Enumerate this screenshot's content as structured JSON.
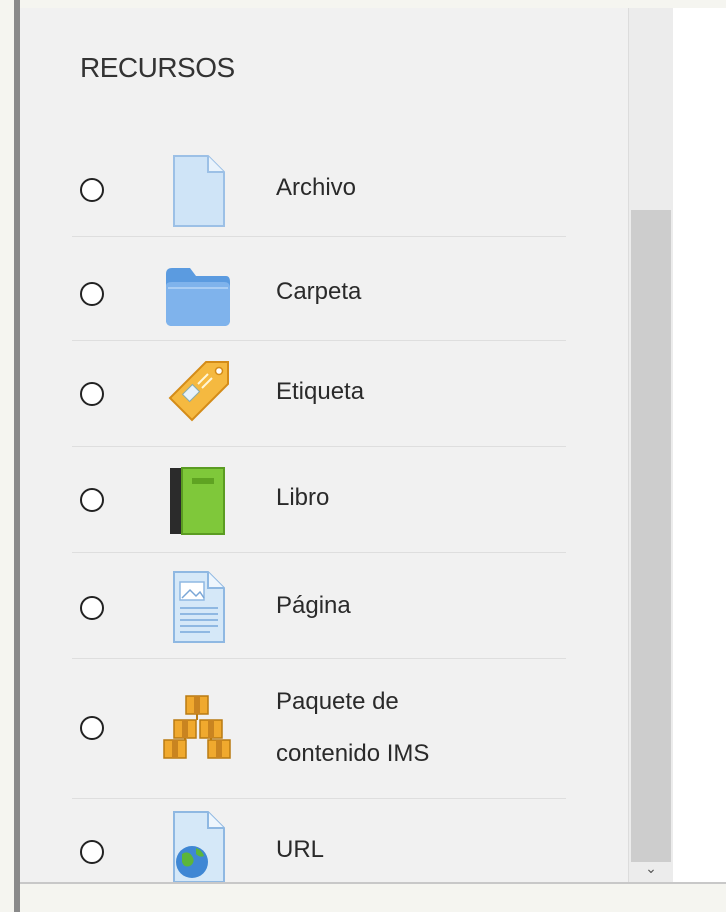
{
  "section": {
    "heading": "RECURSOS"
  },
  "resources": [
    {
      "label": "Archivo",
      "icon": "file-icon"
    },
    {
      "label": "Carpeta",
      "icon": "folder-icon"
    },
    {
      "label": "Etiqueta",
      "icon": "tag-icon"
    },
    {
      "label": "Libro",
      "icon": "book-icon"
    },
    {
      "label": "Página",
      "icon": "page-icon"
    },
    {
      "label_line1": "Paquete de",
      "label_line2": "contenido IMS",
      "icon": "ims-package-icon"
    },
    {
      "label": "URL",
      "icon": "url-icon"
    }
  ],
  "scrollbar": {
    "arrow": "⌄"
  },
  "colors": {
    "panel": "#f1f1f1",
    "scroll_thumb": "#cdcdcd"
  }
}
